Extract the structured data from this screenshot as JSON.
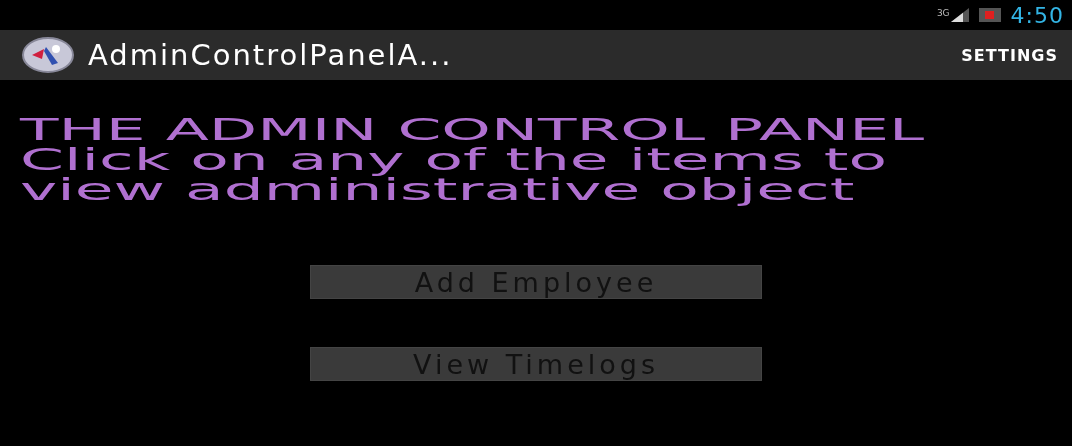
{
  "status_bar": {
    "network_label": "3G",
    "time": "4:50"
  },
  "action_bar": {
    "title": "AdminControlPanelA...",
    "action": "SETTINGS"
  },
  "intro": "THE ADMIN CONTROL PANEL Click on any of the items to view administrative object",
  "buttons": [
    {
      "label": "Add Employee"
    },
    {
      "label": "View Timelogs"
    }
  ]
}
